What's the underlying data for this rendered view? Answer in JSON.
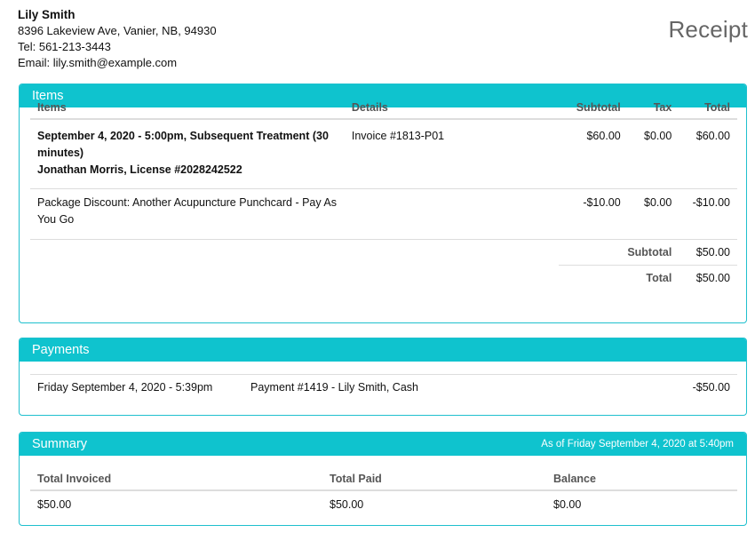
{
  "header": {
    "name": "Lily Smith",
    "address": "8396 Lakeview Ave, Vanier, NB, 94930",
    "tel": "Tel: 561-213-3443",
    "email": "Email: lily.smith@example.com",
    "title": "Receipt"
  },
  "items_panel": {
    "title": "Items",
    "columns": [
      "Items",
      "Details",
      "Subtotal",
      "Tax",
      "Total"
    ],
    "rows": [
      {
        "item_line1": "September 4, 2020 - 5:00pm, Subsequent Treatment (30 minutes)",
        "item_line2": "Jonathan Morris, License #2028242522",
        "details": "Invoice #1813-P01",
        "subtotal": "$60.00",
        "tax": "$0.00",
        "total": "$60.00"
      },
      {
        "item_line1": "Package Discount: Another Acupuncture Punchcard - Pay As You Go",
        "details": "",
        "subtotal": "-$10.00",
        "tax": "$0.00",
        "total": "-$10.00"
      }
    ],
    "totals": [
      {
        "label": "Subtotal",
        "value": "$50.00"
      },
      {
        "label": "Total",
        "value": "$50.00"
      }
    ]
  },
  "payments_panel": {
    "title": "Payments",
    "rows": [
      {
        "date": "Friday September 4, 2020 - 5:39pm",
        "description": "Payment #1419 - Lily Smith, Cash",
        "amount": "-$50.00"
      }
    ]
  },
  "summary_panel": {
    "title": "Summary",
    "as_of": "As of Friday September 4, 2020 at 5:40pm",
    "columns": [
      "Total Invoiced",
      "Total Paid",
      "Balance"
    ],
    "values": [
      "$50.00",
      "$50.00",
      "$0.00"
    ]
  },
  "colors": {
    "accent": "#0fc3ce",
    "border": "#1fc0ce"
  }
}
